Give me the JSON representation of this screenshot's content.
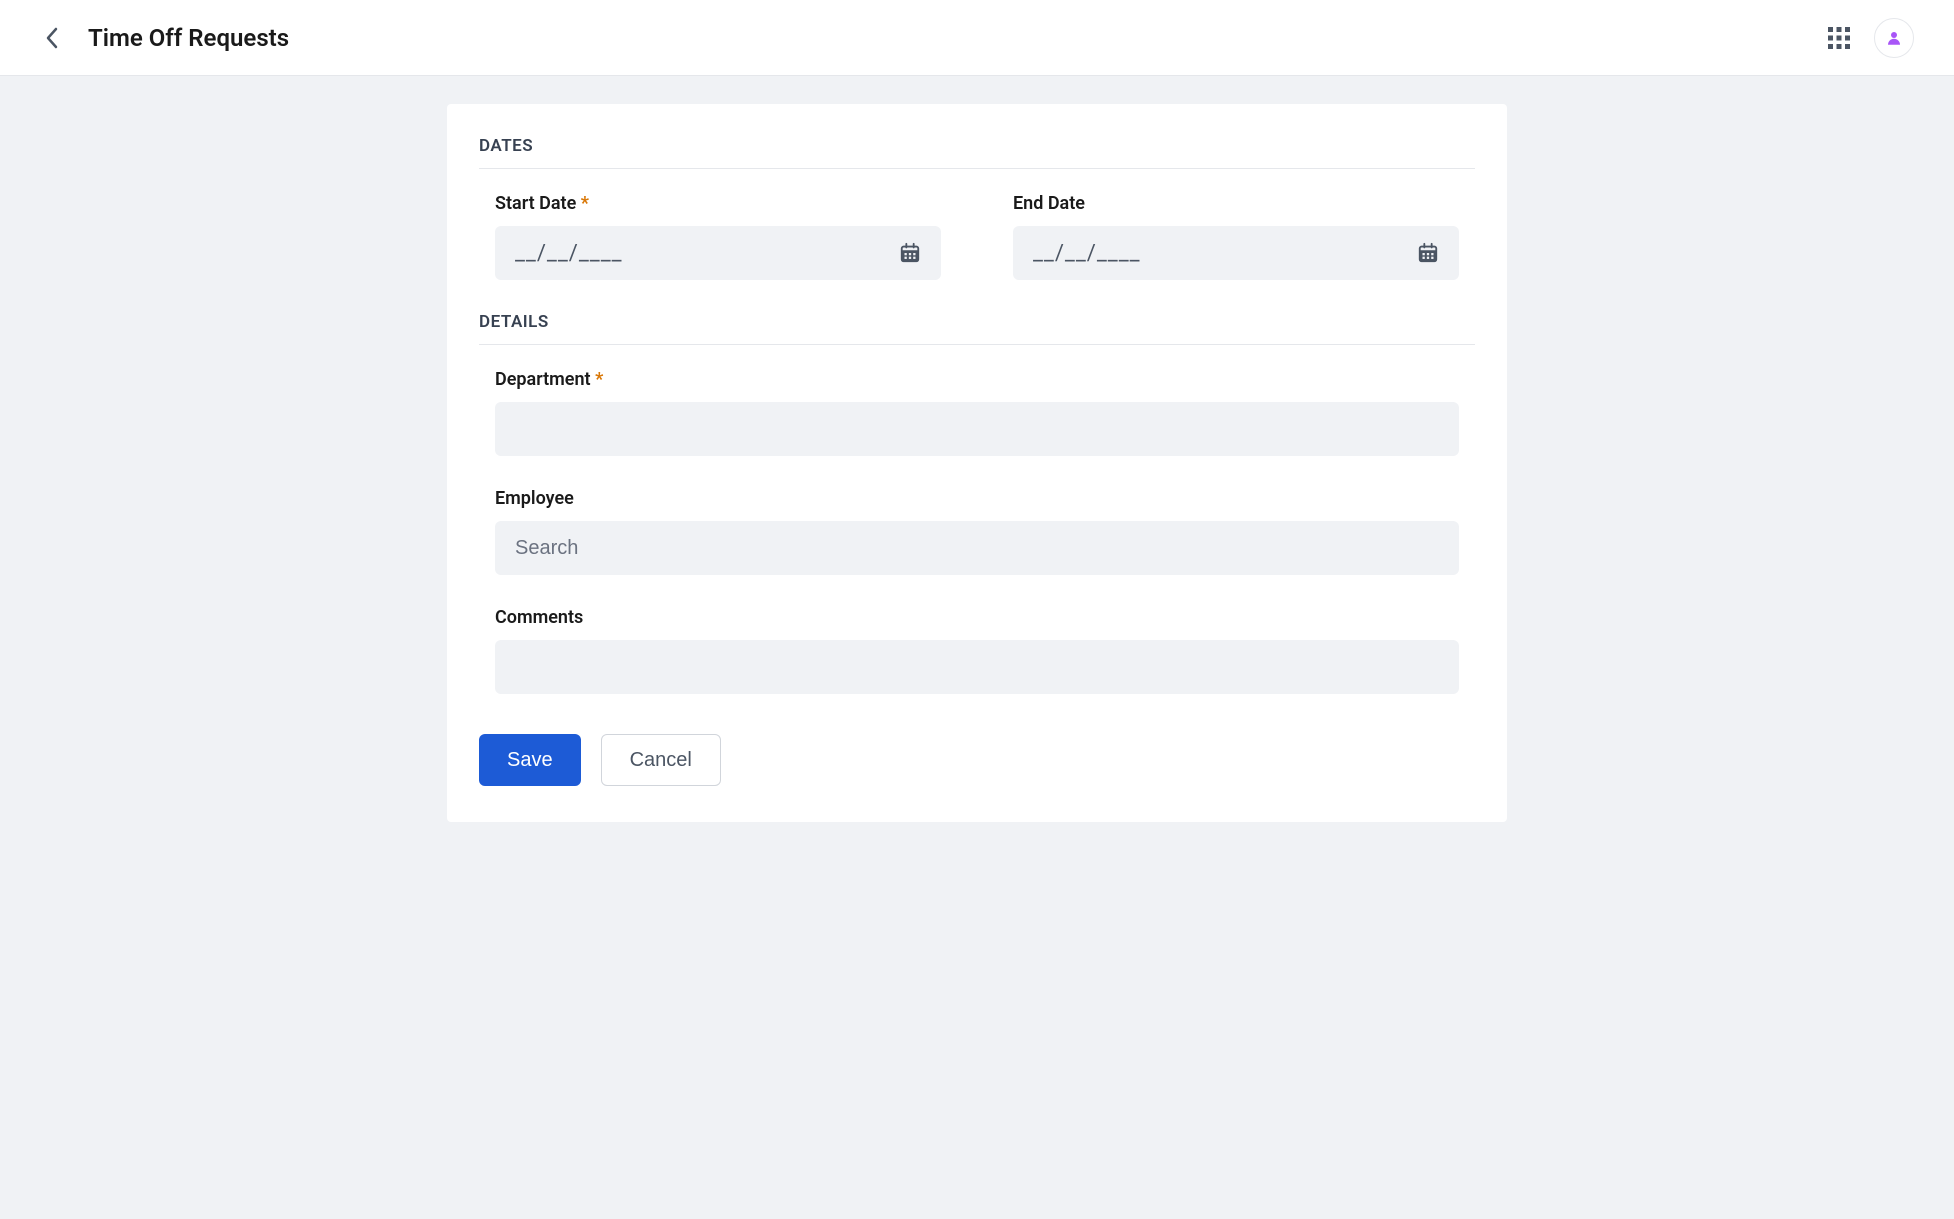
{
  "header": {
    "title": "Time Off Requests"
  },
  "sections": {
    "dates": {
      "title": "DATES",
      "start_date": {
        "label": "Start Date",
        "required": "*",
        "placeholder": "__/__/____"
      },
      "end_date": {
        "label": "End Date",
        "placeholder": "__/__/____"
      }
    },
    "details": {
      "title": "DETAILS",
      "department": {
        "label": "Department",
        "required": "*",
        "value": ""
      },
      "employee": {
        "label": "Employee",
        "placeholder": "Search",
        "value": ""
      },
      "comments": {
        "label": "Comments",
        "value": ""
      }
    }
  },
  "buttons": {
    "save": "Save",
    "cancel": "Cancel"
  }
}
